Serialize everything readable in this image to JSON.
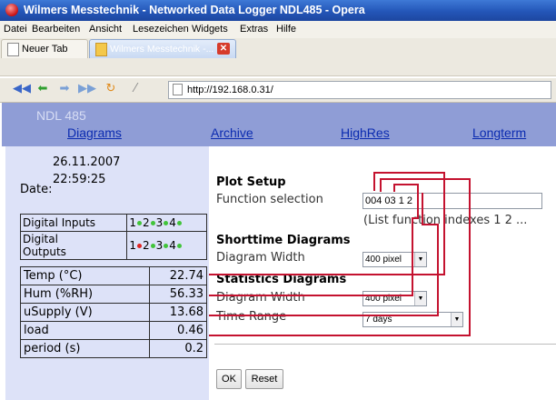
{
  "window": {
    "title": "Wilmers Messtechnik - Networked Data Logger NDL485 - Opera"
  },
  "menu": [
    "Datei",
    "Bearbeiten",
    "Ansicht",
    "Lesezeichen",
    "Widgets",
    "Extras",
    "Hilfe"
  ],
  "tabs": {
    "new_tab": "Neuer Tab",
    "active_tab": "Wilmers Messtechnik -..."
  },
  "address": {
    "url": "http://192.168.0.31/"
  },
  "page": {
    "brand": "NDL 485",
    "nav": [
      "Diagrams",
      "Archive",
      "HighRes",
      "Longterm"
    ],
    "date_label": "Date:",
    "date": "26.11.2007",
    "time": "22:59:25",
    "io": {
      "digital_inputs_label": "Digital Inputs",
      "digital_outputs_label_1": "Digital",
      "digital_outputs_label_2": "Outputs",
      "channels": [
        "1",
        "2",
        "3",
        "4"
      ],
      "input_led_colors": [
        "#41c43a",
        "#41c43a",
        "#41c43a",
        "#41c43a"
      ],
      "output_led_colors": [
        "#e02420",
        "#41c43a",
        "#41c43a",
        "#41c43a"
      ]
    },
    "measurements": [
      {
        "name": "Temp (°C)",
        "value": "22.74"
      },
      {
        "name": "Hum (%RH)",
        "value": "56.33"
      },
      {
        "name": "uSupply (V)",
        "value": "13.68"
      },
      {
        "name": "load",
        "value": "0.46"
      },
      {
        "name": "period (s)",
        "value": "0.2"
      }
    ],
    "plot_setup": {
      "heading": "Plot Setup",
      "function_selection_label": "Function selection",
      "function_selection_value": "004 03 1 2",
      "function_hint": "(List function indexes 1 2 ...",
      "shorttime_heading": "Shorttime Diagrams",
      "shorttime_width_label": "Diagram Width",
      "shorttime_width_value": "400 pixel",
      "statistics_heading": "Statistics Diagrams",
      "statistics_width_label": "Diagram Width",
      "statistics_width_value": "400 pixel",
      "time_range_label": "Time Range",
      "time_range_value": "7 days",
      "ok_label": "OK",
      "reset_label": "Reset"
    },
    "annotation_color": "#c4122f"
  }
}
